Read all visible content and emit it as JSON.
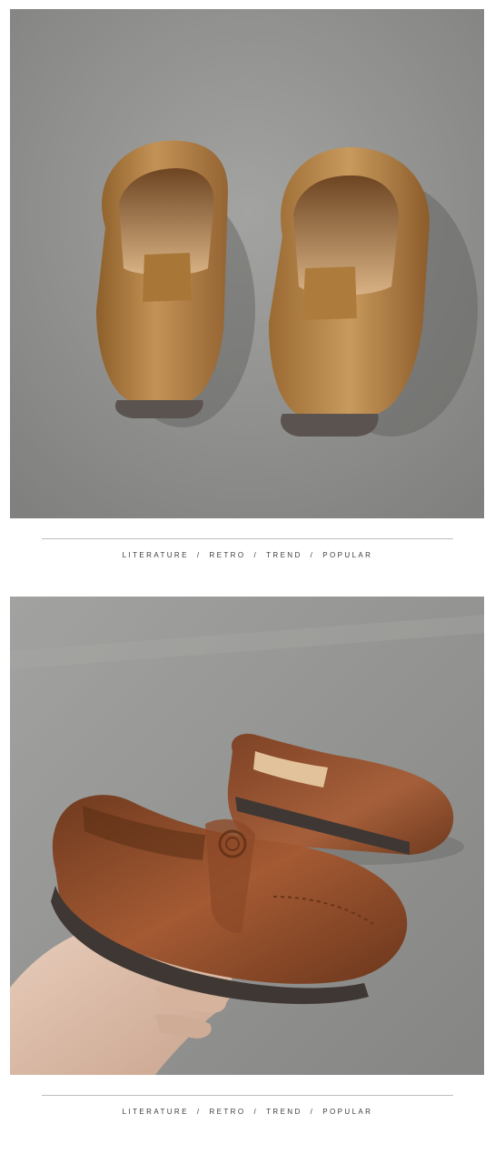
{
  "taglines": [
    {
      "words": [
        "LITERATURE",
        "RETRO",
        "TREND",
        "POPULAR"
      ],
      "separator": "/"
    },
    {
      "words": [
        "LITERATURE",
        "RETRO",
        "TREND",
        "POPULAR"
      ],
      "separator": "/"
    }
  ],
  "colors": {
    "floor_light": "#9b9b99",
    "floor_dark": "#7d7d7b",
    "shoe_tan": "#b07d3e",
    "shoe_brown": "#8a4a28",
    "sole": "#5a5350",
    "divider_line": "#bdbdbd",
    "tagline_text": "#3c3c3c"
  },
  "photos": [
    {
      "subject": "tan-leather-loafers-rear-view"
    },
    {
      "subject": "brown-leather-loafers-held-in-hand"
    }
  ]
}
